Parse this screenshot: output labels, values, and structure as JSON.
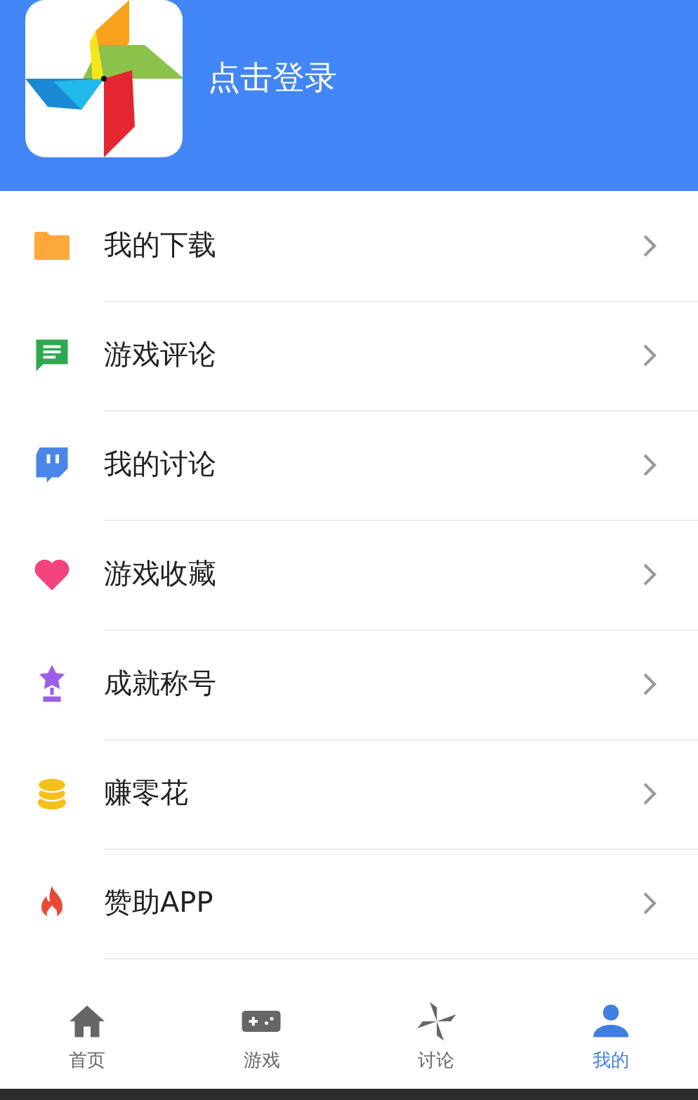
{
  "header": {
    "login_text": "点击登录"
  },
  "menu": [
    {
      "kind": "folder",
      "label": "我的下载"
    },
    {
      "kind": "comment",
      "label": "游戏评论"
    },
    {
      "kind": "chat",
      "label": "我的讨论"
    },
    {
      "kind": "heart",
      "label": "游戏收藏"
    },
    {
      "kind": "trophy",
      "label": "成就称号"
    },
    {
      "kind": "coins",
      "label": "赚零花"
    },
    {
      "kind": "fire",
      "label": "赞助APP"
    }
  ],
  "tabs": [
    {
      "kind": "home",
      "label": "首页",
      "selected": false
    },
    {
      "kind": "gamepad",
      "label": "游戏",
      "selected": false
    },
    {
      "kind": "pinwheel",
      "label": "讨论",
      "selected": false
    },
    {
      "kind": "person",
      "label": "我的",
      "selected": true
    }
  ]
}
